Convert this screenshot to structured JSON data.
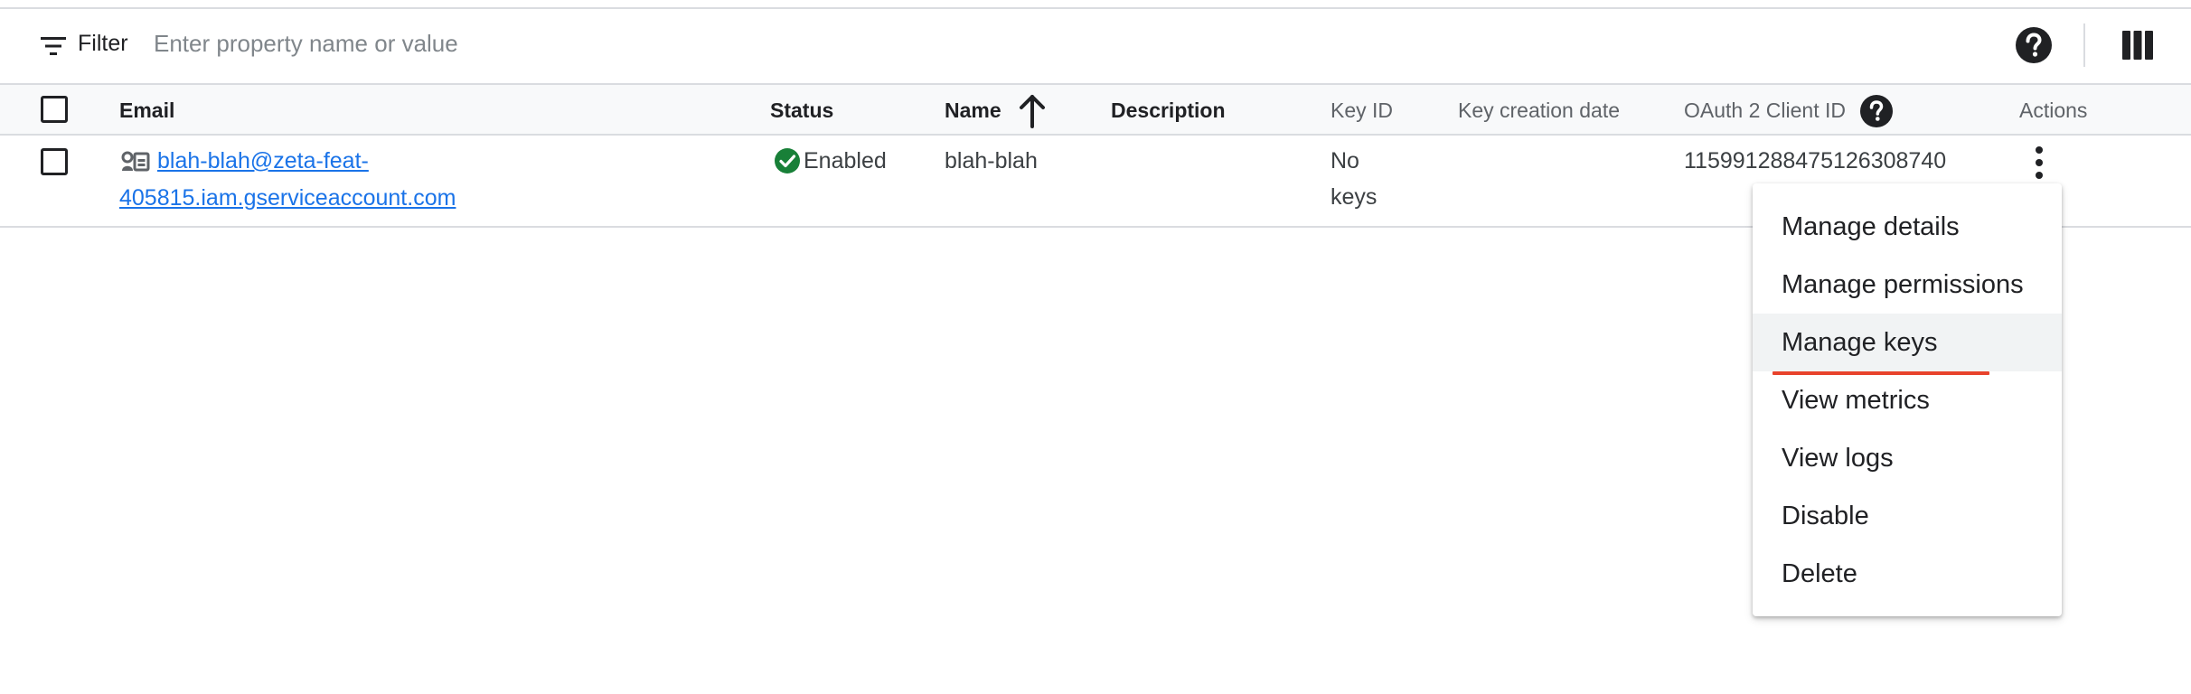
{
  "filter": {
    "label": "Filter",
    "placeholder": "Enter property name or value"
  },
  "toolbar": {
    "help_icon": "help-circle-icon",
    "columns_icon": "column-display-icon"
  },
  "table": {
    "columns": {
      "email": "Email",
      "status": "Status",
      "name": "Name",
      "description": "Description",
      "key_id": "Key ID",
      "key_creation_date": "Key creation date",
      "oauth_client_id": "OAuth 2 Client ID",
      "actions": "Actions"
    },
    "sort": {
      "column": "Name",
      "direction": "ascending"
    },
    "rows": [
      {
        "email_line1": "blah-blah@zeta-feat-",
        "email_line2": "405815.iam.gserviceaccount.com",
        "status": "Enabled",
        "name": "blah-blah",
        "description": "",
        "key_id_line1": "No",
        "key_id_line2": "keys",
        "key_creation_date": "",
        "oauth_client_id": "115991288475126308740"
      }
    ]
  },
  "menu": {
    "items": [
      "Manage details",
      "Manage permissions",
      "Manage keys",
      "View metrics",
      "View logs",
      "Disable",
      "Delete"
    ],
    "highlighted_index": 2
  },
  "colors": {
    "link": "#1a73e8",
    "status_enabled": "#188038",
    "annotation_underline": "#e8432c"
  }
}
